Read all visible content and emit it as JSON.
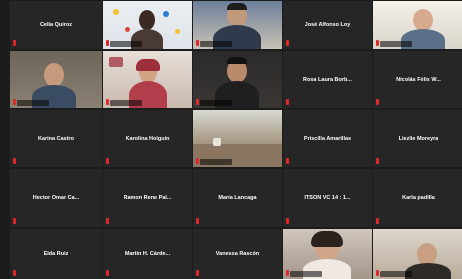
{
  "participants": [
    {
      "name": "Celia Quiroz"
    },
    {
      "name": ""
    },
    {
      "name": ""
    },
    {
      "name": "José Alfonso Loy"
    },
    {
      "name": ""
    },
    {
      "name": ""
    },
    {
      "name": ""
    },
    {
      "name": ""
    },
    {
      "name": "Rosa Laura Borb..."
    },
    {
      "name": "Nicolás Félix W..."
    },
    {
      "name": "Karina Castro"
    },
    {
      "name": "Karolina Holguín"
    },
    {
      "name": ""
    },
    {
      "name": "Priscilla Amarillas"
    },
    {
      "name": "Liezlie Moreyra"
    },
    {
      "name": "Hector Omar Ca..."
    },
    {
      "name": "Ramon Rene Pal..."
    },
    {
      "name": "María Lancaga"
    },
    {
      "name": "ITSON VC 14 : 1..."
    },
    {
      "name": "Karla padilla"
    },
    {
      "name": "Elda Ruiz"
    },
    {
      "name": "Martin H. Cárde..."
    },
    {
      "name": "Vanessa Rascón"
    },
    {
      "name": ""
    },
    {
      "name": ""
    }
  ]
}
